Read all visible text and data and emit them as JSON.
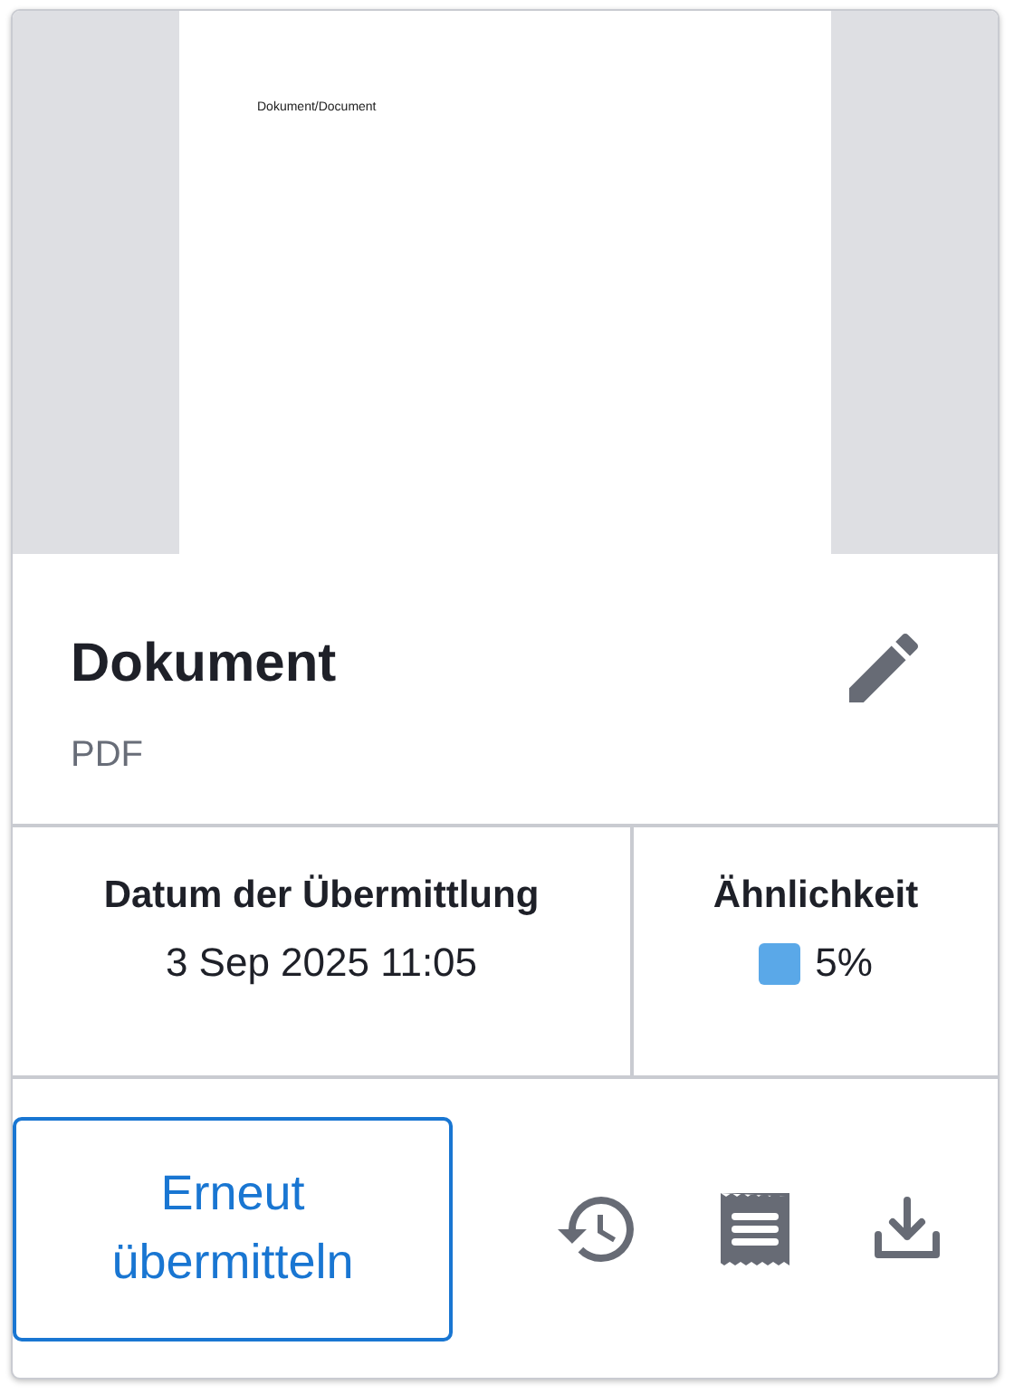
{
  "preview": {
    "page_text": "Dokument/Document"
  },
  "document": {
    "title": "Dokument",
    "type": "PDF"
  },
  "stats": {
    "date_label": "Datum der Übermittlung",
    "date_value": "3 Sep 2025 11:05",
    "similarity_label": "Ähnlichkeit",
    "similarity_value": "5%",
    "similarity": {
      "color": "#5aa8e8"
    }
  },
  "actions": {
    "resubmit_label": "Erneut übermitteln"
  }
}
